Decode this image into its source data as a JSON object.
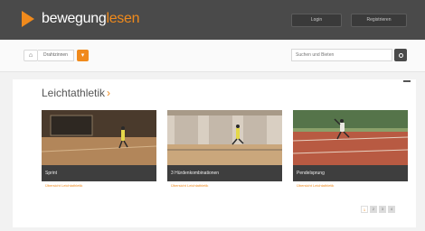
{
  "header": {
    "logo_part1": "bewegung",
    "logo_part2": "lesen",
    "login_label": "Login",
    "register_label": "Registrieren"
  },
  "toolbar": {
    "category_label": "Drahtzinnen",
    "search_placeholder": "Suchen und Bieten"
  },
  "section": {
    "title": "Leichtathletik",
    "arrow": "›"
  },
  "cards": [
    {
      "title": "Sprint",
      "sub": "Übersicht Leichtathletik"
    },
    {
      "title": "3 Hürdenkombinationen",
      "sub": "Übersicht Leichtathletik"
    },
    {
      "title": "Pendelsprung",
      "sub": "Übersicht Leichtathletik"
    }
  ],
  "pager": [
    "1",
    "2",
    "3",
    "4"
  ],
  "colors": {
    "accent": "#f08a1c",
    "header_bg": "#4a4a4a"
  }
}
